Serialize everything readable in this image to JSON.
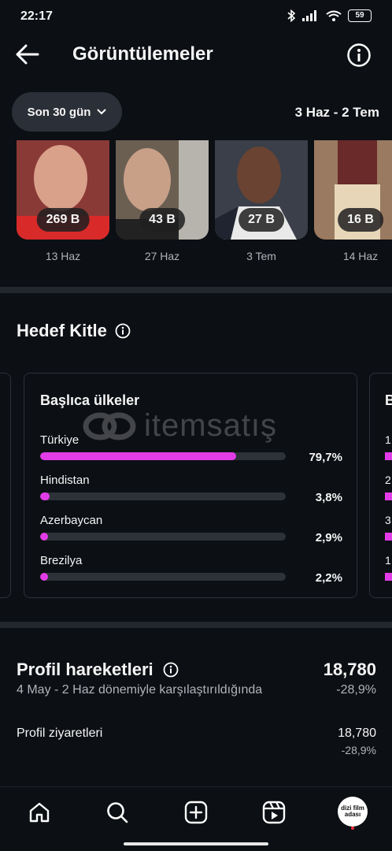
{
  "status_bar": {
    "time": "22:17",
    "battery": "59"
  },
  "header": {
    "title": "Görüntülemeler"
  },
  "filter": {
    "range_label": "Son 30 gün",
    "date_range": "3 Haz - 2 Tem"
  },
  "thumbnails": [
    {
      "count": "269 B",
      "date": "13 Haz",
      "bg": "#8a3a36"
    },
    {
      "count": "43 B",
      "date": "27 Haz",
      "bg": "#6b5f52"
    },
    {
      "count": "27 B",
      "date": "3 Tem",
      "bg": "#3a3f4a"
    },
    {
      "count": "16 B",
      "date": "14 Haz",
      "bg": "#9a7a60"
    }
  ],
  "audience": {
    "title": "Hedef Kitle",
    "card_title": "Başlıca ülkeler",
    "countries": [
      {
        "name": "Türkiye",
        "percent": "79,7%",
        "value": 0.797
      },
      {
        "name": "Hindistan",
        "percent": "3,8%",
        "value": 0.038
      },
      {
        "name": "Azerbaycan",
        "percent": "2,9%",
        "value": 0.029
      },
      {
        "name": "Brezilya",
        "percent": "2,2%",
        "value": 0.022
      }
    ],
    "next_card_letter": "B",
    "next_card_digits": [
      "1",
      "2",
      "3",
      "1"
    ]
  },
  "watermark": {
    "text": "itemsatış"
  },
  "profile": {
    "title": "Profil hareketleri",
    "subtitle": "4 May - 2 Haz dönemiyle karşılaştırıldığında",
    "total": "18,780",
    "change": "-28,9%",
    "metrics": [
      {
        "label": "Profil ziyaretleri",
        "value": "18,780",
        "change": "-28,9%"
      }
    ]
  },
  "bottom_nav": {
    "avatar_text": "dizi film adası"
  },
  "colors": {
    "accent": "#e23ce6",
    "background": "#0c0f14",
    "pill": "#2b2f37"
  }
}
